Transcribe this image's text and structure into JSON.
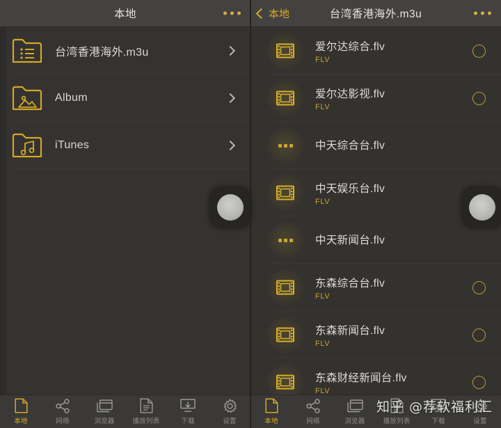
{
  "colors": {
    "accent": "#d8a828",
    "accent_dim": "#c8a42c",
    "bg": "#353331",
    "header_bg": "#434241",
    "tabbar_bg": "#3a3937",
    "text": "#dddcda",
    "text_dim": "#8e8d8a"
  },
  "left_panel": {
    "header": {
      "title": "本地",
      "more_icon": "more-dots-icon"
    },
    "items": [
      {
        "label": "台湾香港海外.m3u",
        "icon": "folder-playlist-icon",
        "chevron": "chevron-right-icon"
      },
      {
        "label": "Album",
        "icon": "folder-photo-icon",
        "chevron": "chevron-right-icon"
      },
      {
        "label": "iTunes",
        "icon": "folder-music-icon",
        "chevron": "chevron-right-icon"
      }
    ]
  },
  "right_panel": {
    "header": {
      "back_label": "本地",
      "back_icon": "chevron-left-icon",
      "title": "台湾香港海外.m3u",
      "more_icon": "more-dots-icon"
    },
    "items": [
      {
        "title": "爱尔达综合.flv",
        "subtitle": "FLV",
        "icon": "film-strip-icon",
        "radio": true
      },
      {
        "title": "爱尔达影视.flv",
        "subtitle": "FLV",
        "icon": "film-strip-icon",
        "radio": true
      },
      {
        "title": "中天综合台.flv",
        "subtitle": "",
        "icon": "loading-dots-icon",
        "radio": false
      },
      {
        "title": "中天娱乐台.flv",
        "subtitle": "FLV",
        "icon": "film-strip-icon",
        "radio": true
      },
      {
        "title": "中天新闻台.flv",
        "subtitle": "",
        "icon": "loading-dots-icon",
        "radio": false
      },
      {
        "title": "东森综合台.flv",
        "subtitle": "FLV",
        "icon": "film-strip-icon",
        "radio": true
      },
      {
        "title": "东森新闻台.flv",
        "subtitle": "FLV",
        "icon": "film-strip-icon",
        "radio": true
      },
      {
        "title": "东森财经新闻台.flv",
        "subtitle": "FLV",
        "icon": "film-strip-icon",
        "radio": true
      }
    ]
  },
  "tabbar": {
    "tabs": [
      {
        "label": "本地",
        "icon": "document-icon",
        "active": true
      },
      {
        "label": "网络",
        "icon": "share-icon",
        "active": false
      },
      {
        "label": "浏览器",
        "icon": "browser-icon",
        "active": false
      },
      {
        "label": "播放列表",
        "icon": "list-icon",
        "active": false
      },
      {
        "label": "下载",
        "icon": "download-icon",
        "active": false
      },
      {
        "label": "设置",
        "icon": "gear-icon",
        "active": false
      }
    ]
  },
  "watermark": {
    "text": "知乎 @荐软福利汇"
  },
  "touch_indicators": [
    {
      "name": "touch-indicator-left"
    },
    {
      "name": "touch-indicator-right"
    }
  ]
}
